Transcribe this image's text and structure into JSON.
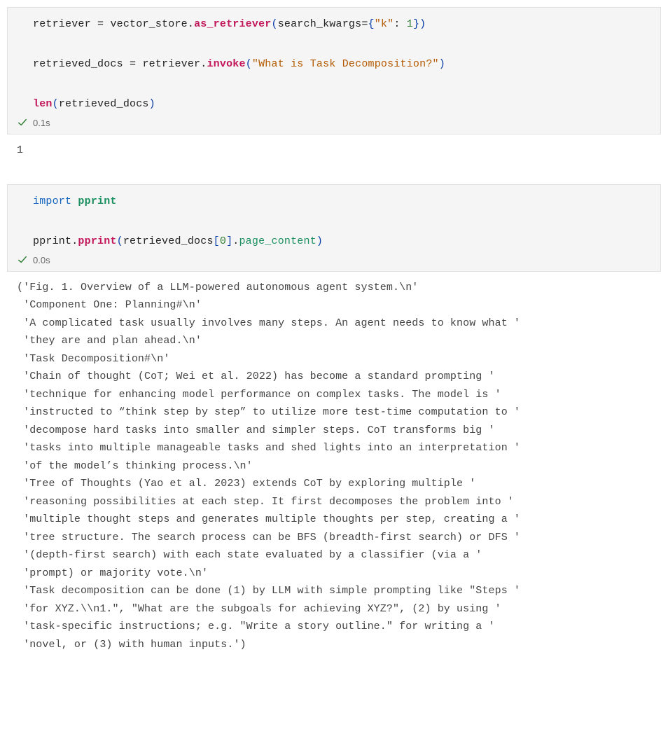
{
  "cell1": {
    "code": {
      "l1": {
        "v_retriever": "retriever",
        "eq": " = ",
        "v_store": "vector_store",
        "dot1": ".",
        "m_as_retriever": "as_retriever",
        "lp": "(",
        "kwarg": "search_kwargs",
        "eq2": "=",
        "lb": "{",
        "key": "\"k\"",
        "colon": ": ",
        "val": "1",
        "rb": "}",
        "rp": ")"
      },
      "l2": {
        "v_docs": "retrieved_docs",
        "eq": " = ",
        "v_retriever": "retriever",
        "dot": ".",
        "m_invoke": "invoke",
        "lp": "(",
        "arg": "\"What is Task Decomposition?\"",
        "rp": ")"
      },
      "l3": {
        "fn_len": "len",
        "lp": "(",
        "arg": "retrieved_docs",
        "rp": ")"
      }
    },
    "status_time": "0.1s",
    "output": "1"
  },
  "cell2": {
    "code": {
      "l1": {
        "kw_import": "import",
        "sp": " ",
        "mod": "pprint"
      },
      "l2": {
        "mod": "pprint",
        "dot": ".",
        "fn": "pprint",
        "lp": "(",
        "arg_obj": "retrieved_docs",
        "lbr": "[",
        "idx": "0",
        "rbr": "]",
        "dot2": ".",
        "attr": "page_content",
        "rp": ")"
      }
    },
    "status_time": "0.0s",
    "output_lines": [
      "('Fig. 1. Overview of a LLM-powered autonomous agent system.\\n'",
      " 'Component One: Planning#\\n'",
      " 'A complicated task usually involves many steps. An agent needs to know what '",
      " 'they are and plan ahead.\\n'",
      " 'Task Decomposition#\\n'",
      " 'Chain of thought (CoT; Wei et al. 2022) has become a standard prompting '",
      " 'technique for enhancing model performance on complex tasks. The model is '",
      " 'instructed to “think step by step” to utilize more test-time computation to '",
      " 'decompose hard tasks into smaller and simpler steps. CoT transforms big '",
      " 'tasks into multiple manageable tasks and shed lights into an interpretation '",
      " 'of the model’s thinking process.\\n'",
      " 'Tree of Thoughts (Yao et al. 2023) extends CoT by exploring multiple '",
      " 'reasoning possibilities at each step. It first decomposes the problem into '",
      " 'multiple thought steps and generates multiple thoughts per step, creating a '",
      " 'tree structure. The search process can be BFS (breadth-first search) or DFS '",
      " '(depth-first search) with each state evaluated by a classifier (via a '",
      " 'prompt) or majority vote.\\n'",
      " 'Task decomposition can be done (1) by LLM with simple prompting like \"Steps '",
      " 'for XYZ.\\\\n1.\", \"What are the subgoals for achieving XYZ?\", (2) by using '",
      " 'task-specific instructions; e.g. \"Write a story outline.\" for writing a '",
      " 'novel, or (3) with human inputs.')"
    ]
  }
}
